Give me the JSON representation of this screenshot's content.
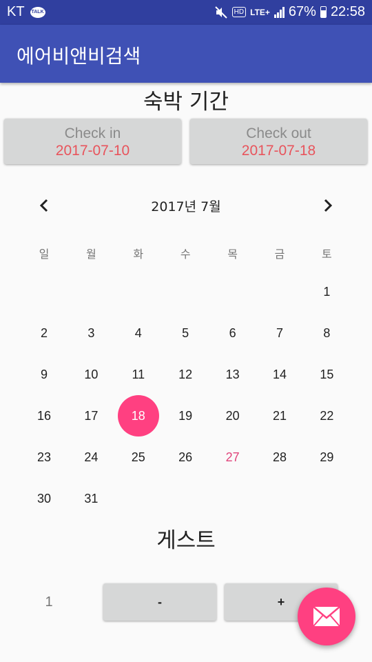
{
  "status_bar": {
    "carrier": "KT",
    "talk_badge": "TALK",
    "hd": "HD",
    "network": "LTE+",
    "battery": "67%",
    "time": "22:58",
    "icons": [
      "kakaotalk-icon",
      "mute-icon",
      "hd-icon",
      "lte-icon",
      "signal-icon",
      "battery-icon"
    ]
  },
  "app_bar": {
    "title": "에어비앤비검색"
  },
  "stay": {
    "title": "숙박 기간",
    "check_in": {
      "label": "Check in",
      "date": "2017-07-10"
    },
    "check_out": {
      "label": "Check out",
      "date": "2017-07-18"
    }
  },
  "calendar": {
    "month_title": "2017년 7월",
    "weekdays": [
      "일",
      "월",
      "화",
      "수",
      "목",
      "금",
      "토"
    ],
    "days": [
      "1",
      "2",
      "3",
      "4",
      "5",
      "6",
      "7",
      "8",
      "9",
      "10",
      "11",
      "12",
      "13",
      "14",
      "15",
      "16",
      "17",
      "18",
      "19",
      "20",
      "21",
      "22",
      "23",
      "24",
      "25",
      "26",
      "27",
      "28",
      "29",
      "30",
      "31"
    ],
    "first_weekday_index": 6,
    "selected_day": "18",
    "today": "27"
  },
  "guests": {
    "title": "게스트",
    "count": "1",
    "minus_label": "-",
    "plus_label": "+"
  },
  "colors": {
    "status_bar": "#303f9f",
    "app_bar": "#3f51b5",
    "accent": "#ff4081",
    "date_text": "#e8545c",
    "button_bg": "#d6d7d7"
  },
  "fab": {
    "icon": "mail-icon"
  }
}
